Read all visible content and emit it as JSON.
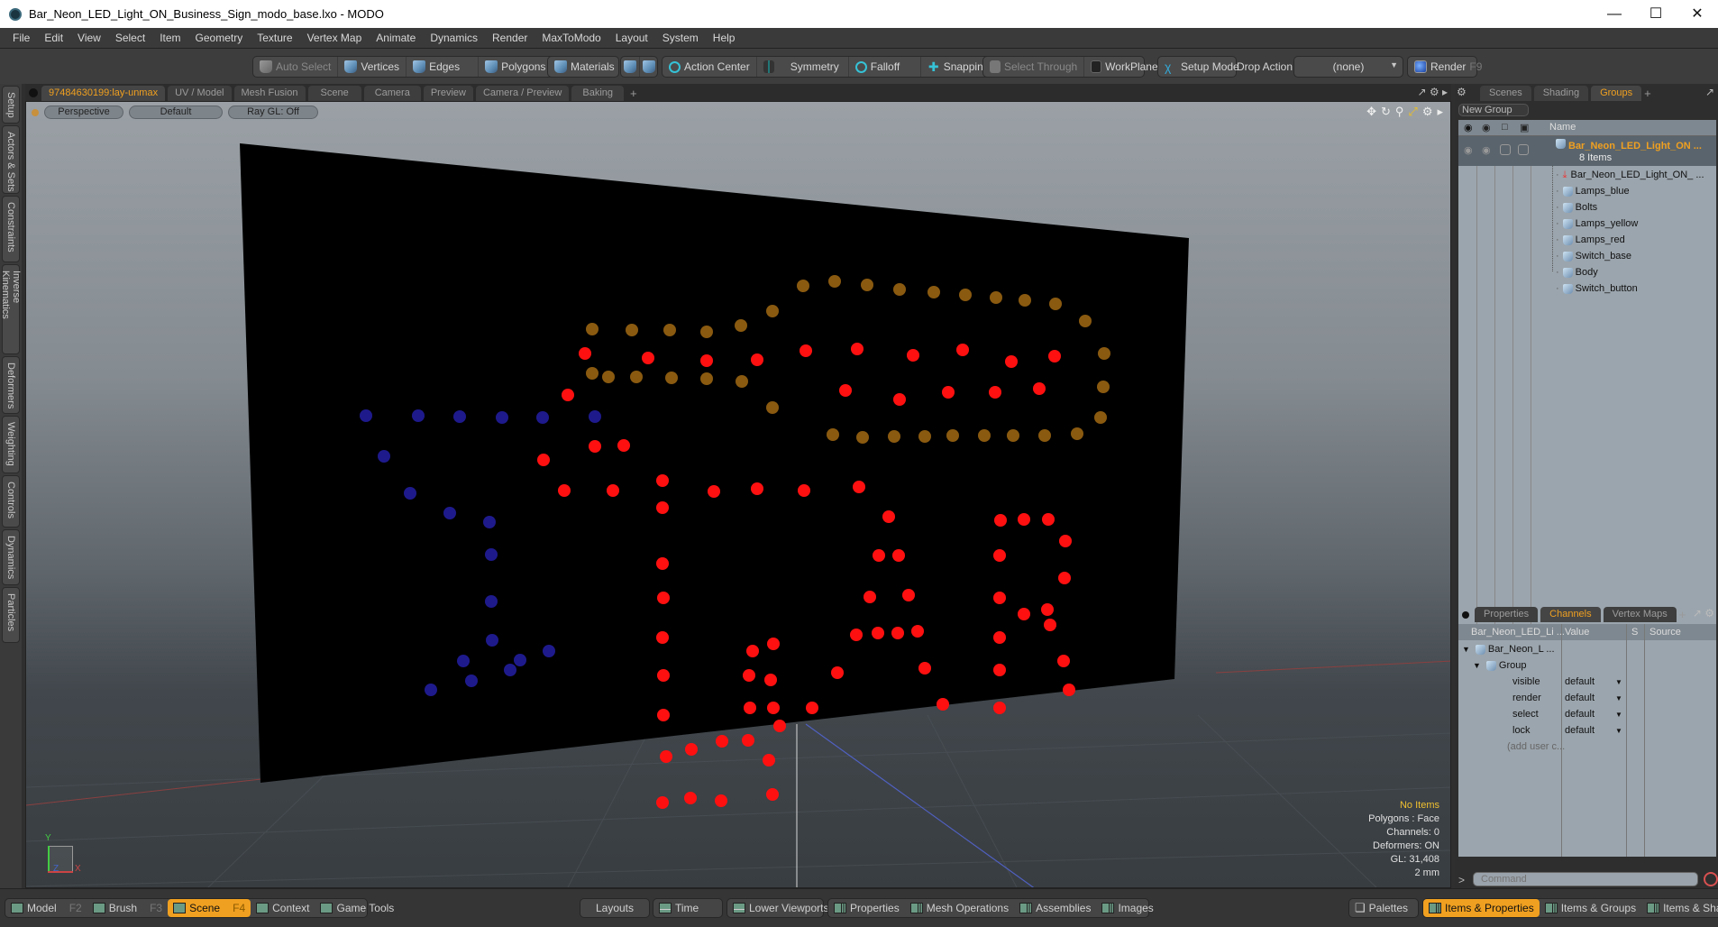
{
  "window": {
    "title": "Bar_Neon_LED_Light_ON_Business_Sign_modo_base.lxo - MODO",
    "controls": [
      "minimize",
      "maximize",
      "close"
    ]
  },
  "menu": [
    "File",
    "Edit",
    "View",
    "Select",
    "Item",
    "Geometry",
    "Texture",
    "Vertex Map",
    "Animate",
    "Dynamics",
    "Render",
    "MaxToModo",
    "Layout",
    "System",
    "Help"
  ],
  "toolbar": {
    "auto_select": "Auto Select",
    "vertices": "Vertices",
    "edges": "Edges",
    "polygons": "Polygons",
    "materials": "Materials",
    "action_center": "Action Center",
    "symmetry": "Symmetry",
    "falloff": "Falloff",
    "snapping": "Snapping",
    "select_through": "Select Through",
    "workplane": "WorkPlane",
    "setup_mode": "Setup Mode",
    "drop_action_label": "Drop Action",
    "drop_action_value": "(none)",
    "render": "Render",
    "render_key": "F9"
  },
  "left_tabs": [
    "Setup",
    "Actors & Sets",
    "Constraints",
    "Inverse Kinematics",
    "Deformers",
    "Weighting",
    "Controls",
    "Dynamics",
    "Particles"
  ],
  "viewport_tabs": {
    "items": [
      "97484630199:lay-unmax",
      "UV / Model",
      "Mesh Fusion",
      "Scene",
      "Camera",
      "Preview",
      "Camera / Preview",
      "Baking"
    ],
    "active": 0,
    "add": "+"
  },
  "viewport": {
    "view": "Perspective",
    "shading": "Default",
    "raygl": "Ray GL: Off",
    "hud": {
      "selection": "No Items",
      "polygons": "Polygons : Face",
      "channels": "Channels: 0",
      "deformers": "Deformers: ON",
      "gl": "GL: 31,408",
      "unit": "2 mm"
    },
    "axes": {
      "y": "Y",
      "x": "X",
      "z": "Z"
    },
    "led_colors": {
      "blue": "#1e1a8c",
      "red": "#ff1010",
      "amber": "#8a5a10",
      "board": "#000000"
    }
  },
  "right_top": {
    "tabs": [
      "Scenes",
      "Shading",
      "Groups"
    ],
    "active": 2,
    "add": "+",
    "new_group": "New Group",
    "header": {
      "name": "Name"
    },
    "group": {
      "name": "Bar_Neon_LED_Light_ON ...",
      "count": "8 Items"
    },
    "items": [
      "Bar_Neon_LED_Light_ON_ ...",
      "Lamps_blue",
      "Bolts",
      "Lamps_yellow",
      "Lamps_red",
      "Switch_base",
      "Body",
      "Switch_button"
    ]
  },
  "right_bottom": {
    "tabs": [
      "Properties",
      "Channels",
      "Vertex Maps"
    ],
    "active": 1,
    "add": "+",
    "columns": [
      "Bar_Neon_LED_Li ...",
      "Value",
      "S",
      "Source"
    ],
    "root": "Bar_Neon_L ...",
    "group": "Group",
    "channels": [
      {
        "name": "visible",
        "value": "default"
      },
      {
        "name": "render",
        "value": "default"
      },
      {
        "name": "select",
        "value": "default"
      },
      {
        "name": "lock",
        "value": "default"
      }
    ],
    "add_user": "(add user c...",
    "command_placeholder": "Command",
    "prompt": ">"
  },
  "bottom": {
    "modes": [
      {
        "label": "Model",
        "key": "F2"
      },
      {
        "label": "Brush",
        "key": "F3"
      },
      {
        "label": "Scene",
        "key": "F4",
        "active": true
      },
      {
        "label": "Context",
        "key": ""
      },
      {
        "label": "Game Tools",
        "key": ""
      }
    ],
    "layouts": "Layouts",
    "time": "Time",
    "lower_viewports": "Lower Viewports",
    "panels": [
      "Properties",
      "Mesh Operations",
      "Assemblies",
      "Images"
    ],
    "palettes": "Palettes",
    "workspaces": [
      "Items & Properties",
      "Items & Groups",
      "Items & Shading"
    ],
    "active_workspace": 0
  }
}
